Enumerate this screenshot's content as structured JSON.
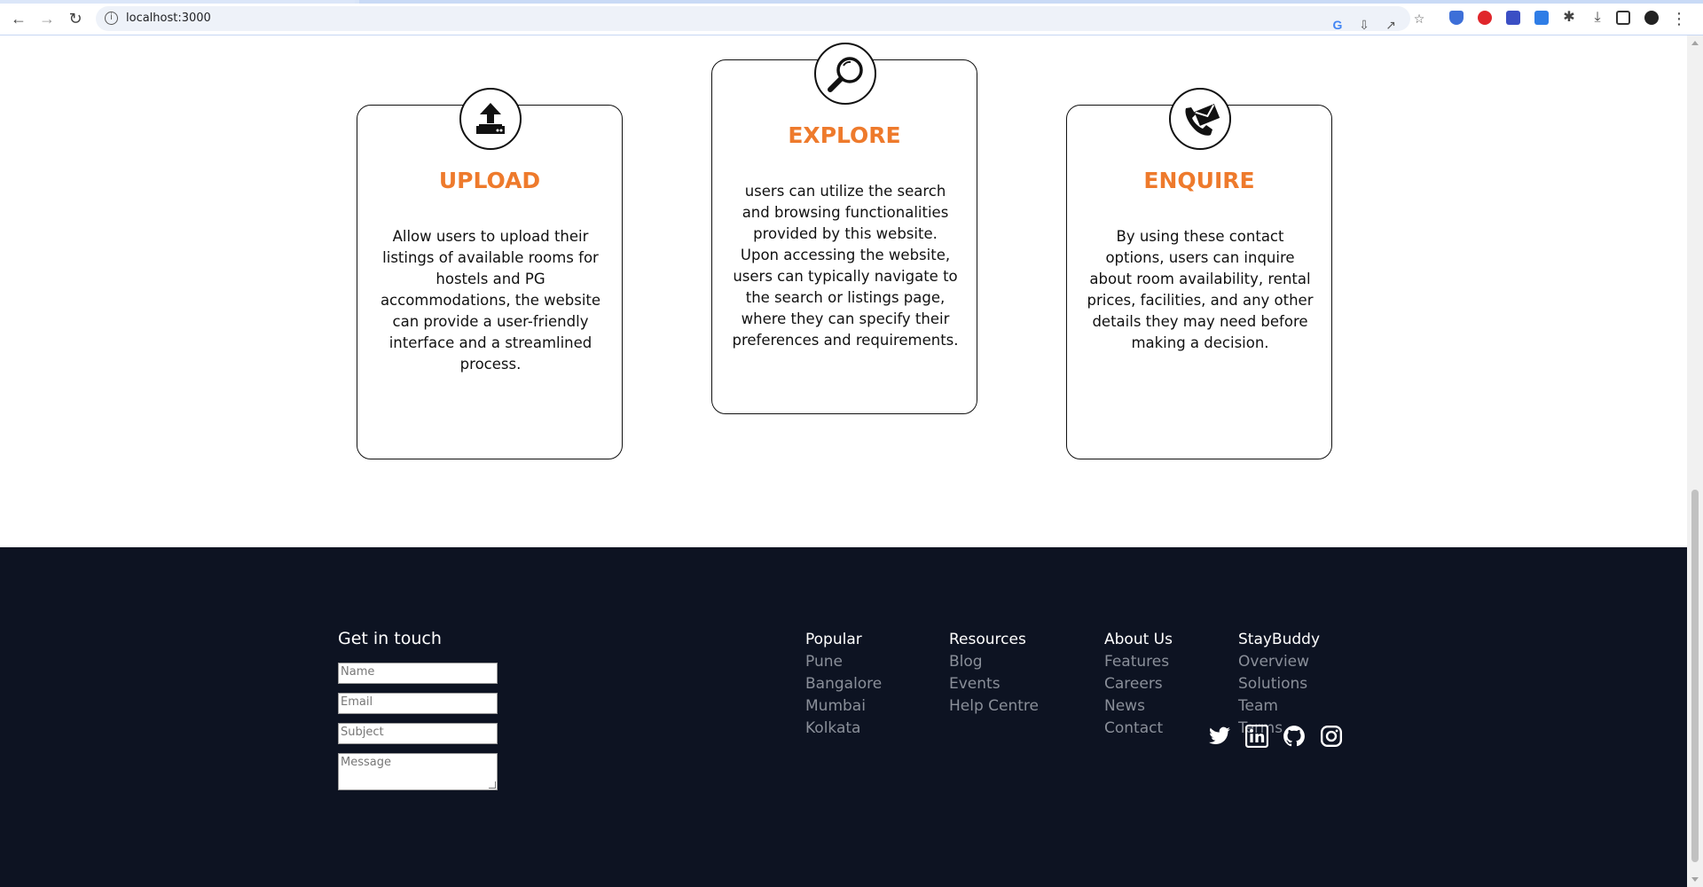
{
  "browser": {
    "url": "localhost:3000"
  },
  "cards": [
    {
      "icon": "upload-icon",
      "title": "UPLOAD",
      "text": "Allow users to upload their listings of available rooms for hostels and PG accommodations, the website can provide a user-friendly interface and a streamlined process."
    },
    {
      "icon": "search-icon",
      "title": "EXPLORE",
      "text": "users can utilize the search and browsing functionalities provided by this website. Upon accessing the website, users can typically navigate to the search or listings page, where they can specify their preferences and requirements."
    },
    {
      "icon": "phone-mail-icon",
      "title": "ENQUIRE",
      "text": "By using these contact options, users can inquire about room availability, rental prices, facilities, and any other details they may need before making a decision."
    }
  ],
  "footer": {
    "contact_title": "Get in touch",
    "fields": {
      "name_placeholder": "Name",
      "email_placeholder": "Email",
      "subject_placeholder": "Subject",
      "message_placeholder": "Message"
    },
    "columns": [
      {
        "title": "Popular",
        "links": [
          "Pune",
          "Bangalore",
          "Mumbai",
          "Kolkata"
        ]
      },
      {
        "title": "Resources",
        "links": [
          "Blog",
          "Events",
          "Help Centre"
        ]
      },
      {
        "title": "About Us",
        "links": [
          "Features",
          "Careers",
          "News",
          "Contact"
        ]
      },
      {
        "title": "StayBuddy",
        "links": [
          "Overview",
          "Solutions",
          "Team",
          "Terms"
        ]
      }
    ],
    "social": [
      "twitter-icon",
      "linkedin-icon",
      "github-icon",
      "instagram-icon"
    ]
  },
  "colors": {
    "accent": "#ee7a2c",
    "footer_bg": "#0d1322",
    "footer_link": "#8a8f99"
  }
}
